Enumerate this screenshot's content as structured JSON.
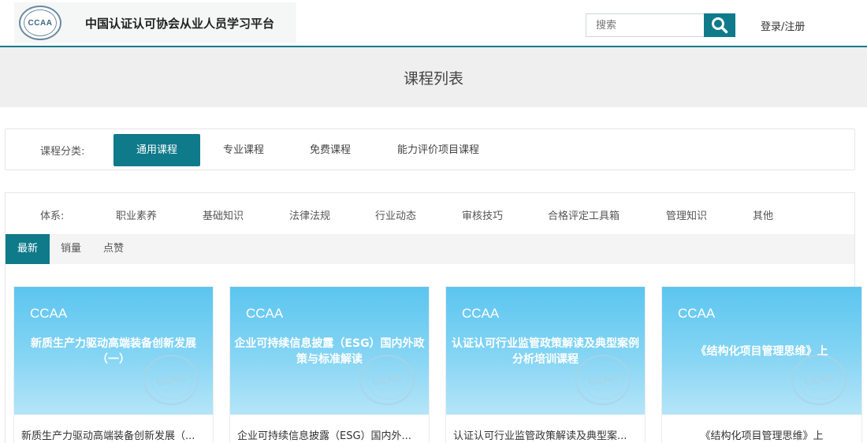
{
  "header": {
    "logo_text": "CCAA",
    "site_title": "中国认证认可协会从业人员学习平台",
    "search_placeholder": "搜索",
    "login_label": "登录/注册"
  },
  "banner": {
    "title": "课程列表"
  },
  "category": {
    "label": "课程分类:",
    "tabs": [
      "通用课程",
      "专业课程",
      "免费课程",
      "能力评价项目课程"
    ],
    "active_index": 0
  },
  "system": {
    "label": "体系:",
    "items": [
      "职业素养",
      "基础知识",
      "法律法规",
      "行业动态",
      "审核技巧",
      "合格评定工具箱",
      "管理知识",
      "其他"
    ]
  },
  "sort": {
    "tabs": [
      "最新",
      "销量",
      "点赞"
    ],
    "active_index": 0
  },
  "courses": [
    {
      "brand": "CCAA",
      "thumb_title": "新质生产力驱动高端装备创新发展（一）",
      "seal": "CCAA",
      "caption": "新质生产力驱动高端装备创新发展（..."
    },
    {
      "brand": "CCAA",
      "thumb_title": "企业可持续信息披露（ESG）国内外政策与标准解读",
      "seal": "CCAA",
      "caption": "企业可持续信息披露（ESG）国内外..."
    },
    {
      "brand": "CCAA",
      "thumb_title": "认证认可行业监管政策解读及典型案例分析培训课程",
      "seal": "CCAA",
      "caption": "认证认可行业监管政策解读及典型案..."
    },
    {
      "brand": "CCAA",
      "thumb_title": "《结构化项目管理思维》上",
      "seal": "CCAA",
      "caption": "《结构化项目管理思维》上"
    }
  ],
  "colors": {
    "accent": "#0e7a8a",
    "thumb_blue": "#5bc5ef"
  },
  "icons": {
    "search": "search-icon"
  }
}
